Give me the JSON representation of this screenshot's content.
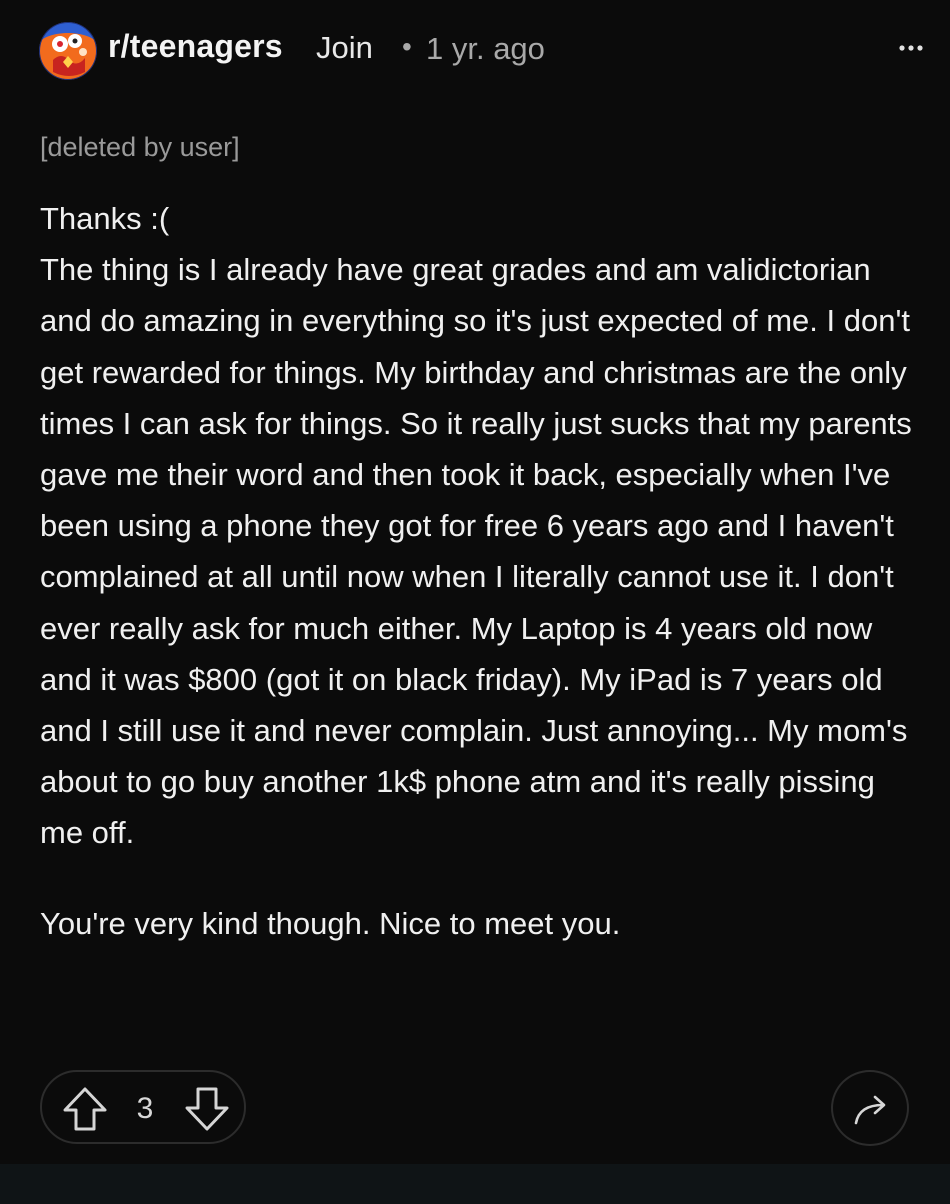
{
  "header": {
    "subreddit": "r/teenagers",
    "join_label": "Join",
    "separator": "•",
    "timestamp": "1 yr. ago",
    "avatar_icon": "subreddit-avatar",
    "more_icon": "more-options-icon"
  },
  "post": {
    "parent_ref": "[deleted by user]",
    "paragraphs": [
      "Thanks :(",
      "The thing is I already have great grades and am validictorian and do amazing in everything so it's just expected of me. I don't get rewarded for things. My birthday and christmas are the only times I can ask for things. So it really just sucks that my parents gave me their word and then took it back, especially when I've been using a phone they got for free 6 years ago and I haven't complained at all until now when I literally cannot use it. I don't ever really ask for much either. My Laptop is 4 years old now and it was $800 (got it on black friday). My iPad is 7 years old and I still use it and never complain. Just annoying... My mom's about to go buy another 1k$ phone atm and it's really pissing me off.",
      "You're very kind though. Nice to meet you."
    ]
  },
  "actions": {
    "vote_count": "3",
    "upvote_icon": "upvote-arrow-icon",
    "downvote_icon": "downvote-arrow-icon",
    "share_icon": "share-arrow-icon"
  },
  "colors": {
    "background": "#0b0b0b",
    "text": "#f0f0f0",
    "muted": "#a9a9a9",
    "border": "#2c2c2c"
  }
}
